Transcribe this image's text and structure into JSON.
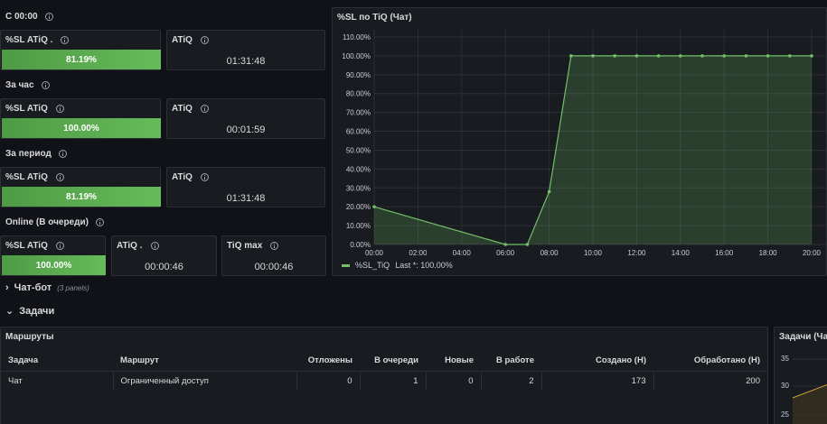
{
  "sections": {
    "since_midnight": "С 00:00",
    "per_hour": "За час",
    "per_period": "За период",
    "online": "Online (В очереди)"
  },
  "stats": {
    "s1_sl_title": "%SL ATiQ .",
    "s1_sl_value": "81.19%",
    "s1_sl_fraction": 0.8119,
    "s1_atiq_title": "ATiQ",
    "s1_atiq_value": "01:31:48",
    "s2_sl_title": "%SL ATiQ",
    "s2_sl_value": "100.00%",
    "s2_sl_fraction": 1.0,
    "s2_atiq_title": "ATiQ",
    "s2_atiq_value": "00:01:59",
    "s3_sl_title": "%SL ATiQ",
    "s3_sl_value": "81.19%",
    "s3_sl_fraction": 0.8119,
    "s3_atiq_title": "ATiQ",
    "s3_atiq_value": "01:31:48",
    "s4_sl_title": "%SL ATiQ",
    "s4_sl_value": "100.00%",
    "s4_sl_fraction": 1.0,
    "s4_atiq_title": "ATiQ .",
    "s4_atiq_value": "00:00:46",
    "s4_tiqmax_title": "TiQ max",
    "s4_tiqmax_value": "00:00:46"
  },
  "chart_panel": {
    "title": "%SL по TiQ (Чат)",
    "legend_label": "%SL_TiQ",
    "legend_last": "Last *: 100.00%"
  },
  "chart_data": {
    "type": "area",
    "series": [
      {
        "name": "%SL_TiQ",
        "x": [
          "00:00",
          "06:00",
          "07:00",
          "08:00",
          "09:00",
          "10:00",
          "11:00",
          "12:00",
          "13:00",
          "14:00",
          "15:00",
          "16:00",
          "17:00",
          "18:00",
          "19:00",
          "20:00"
        ],
        "values": [
          20,
          0,
          0,
          28,
          100,
          100,
          100,
          100,
          100,
          100,
          100,
          100,
          100,
          100,
          100,
          100
        ]
      }
    ],
    "x_ticks": [
      "00:00",
      "02:00",
      "04:00",
      "06:00",
      "08:00",
      "10:00",
      "12:00",
      "14:00",
      "16:00",
      "18:00",
      "20:00"
    ],
    "y_ticks": [
      "0.00%",
      "10.00%",
      "20.00%",
      "30.00%",
      "40.00%",
      "50.00%",
      "60.00%",
      "70.00%",
      "80.00%",
      "90.00%",
      "100.00%",
      "110.00%"
    ],
    "ylim": [
      0,
      110
    ],
    "xlim_hours": [
      0,
      20
    ],
    "grid": true,
    "color": "#73bf69",
    "legend_position": "bottom-left"
  },
  "rows": {
    "chatbot_title": "Чат-бот",
    "chatbot_sub": "(3 panels)",
    "tasks_title": "Задачи"
  },
  "routes_panel": {
    "title": "Маршруты",
    "columns": [
      "Задача",
      "Маршрут",
      "Отложены",
      "В очереди",
      "Новые",
      "В работе",
      "Создано (Н)",
      "Обработано (Н)"
    ],
    "rows": [
      [
        "Чат",
        "Ограниченный доступ",
        "0",
        "1",
        "0",
        "2",
        "173",
        "200"
      ]
    ]
  },
  "tasks_chart_panel": {
    "title": "Задачи (Ча",
    "y_ticks": [
      "35",
      "30",
      "25"
    ]
  },
  "colors": {
    "background": "#111217",
    "panel": "#181b1f",
    "green": "#73bf69",
    "green_bar": "#56a64b"
  }
}
